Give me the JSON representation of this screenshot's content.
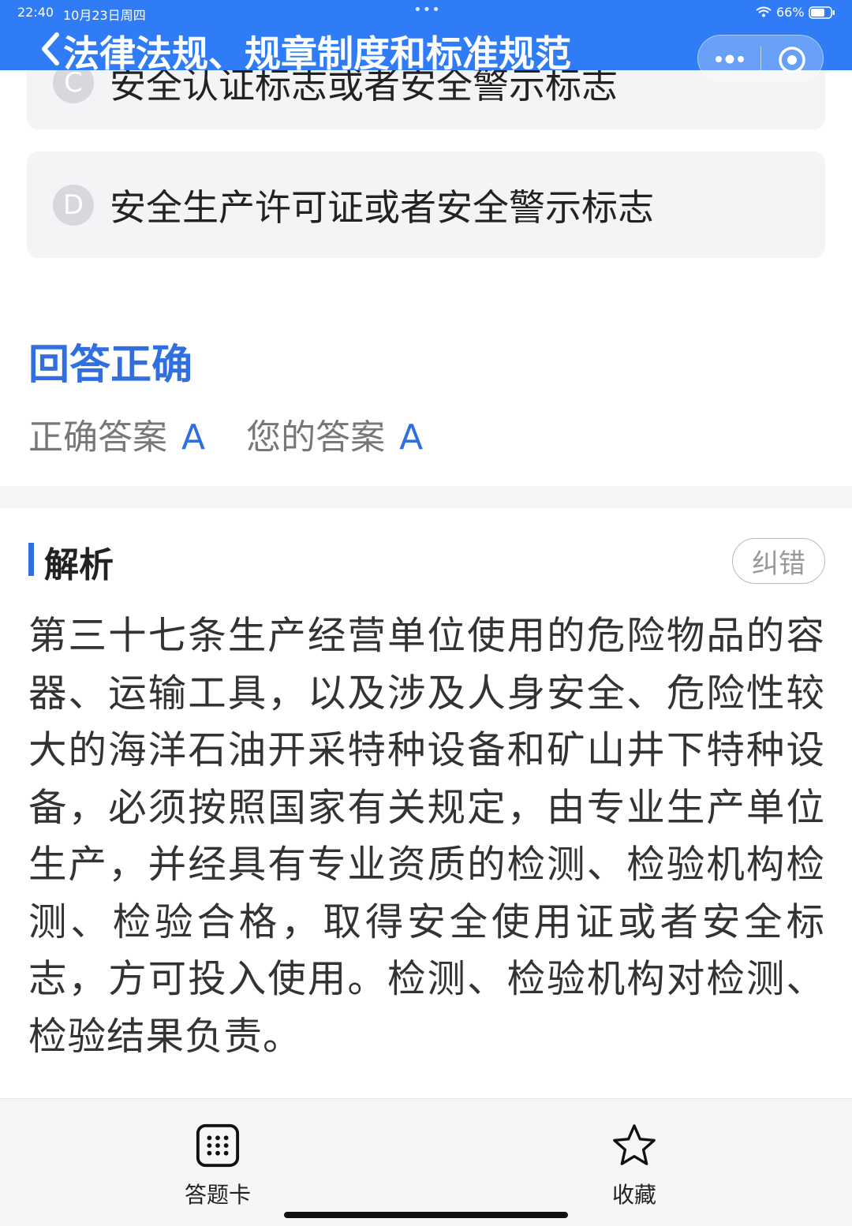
{
  "status_bar": {
    "time": "22:40",
    "date": "10月23日周四",
    "dots": "•••",
    "battery": "66%"
  },
  "header": {
    "title": "法律法规、规章制度和标准规范",
    "accent_color": "#2f7cf6"
  },
  "options": [
    {
      "letter": "C",
      "text": "安全认证标志或者安全警示标志"
    },
    {
      "letter": "D",
      "text": "安全生产许可证或者安全警示标志"
    }
  ],
  "result": {
    "title": "回答正确",
    "correct_label": "正确答案",
    "correct_value": "A",
    "yours_label": "您的答案",
    "yours_value": "A"
  },
  "analysis": {
    "title": "解析",
    "report_label": "纠错",
    "text": "第三十七条生产经营单位使用的危险物品的容器、运输工具，以及涉及人身安全、危险性较大的海洋石油开采特种设备和矿山井下特种设备，必须按照国家有关规定，由专业生产单位生产，并经具有专业资质的检测、检验机构检测、检验合格，取得安全使用证或者安全标志，方可投入使用。检测、检验机构对检测、检验结果负责。"
  },
  "bottom_bar": {
    "card_label": "答题卡",
    "favorite_label": "收藏"
  },
  "icons": [
    "back-icon",
    "more-icon",
    "target-icon",
    "wifi-icon",
    "battery-icon",
    "answer-card-icon",
    "star-icon"
  ]
}
